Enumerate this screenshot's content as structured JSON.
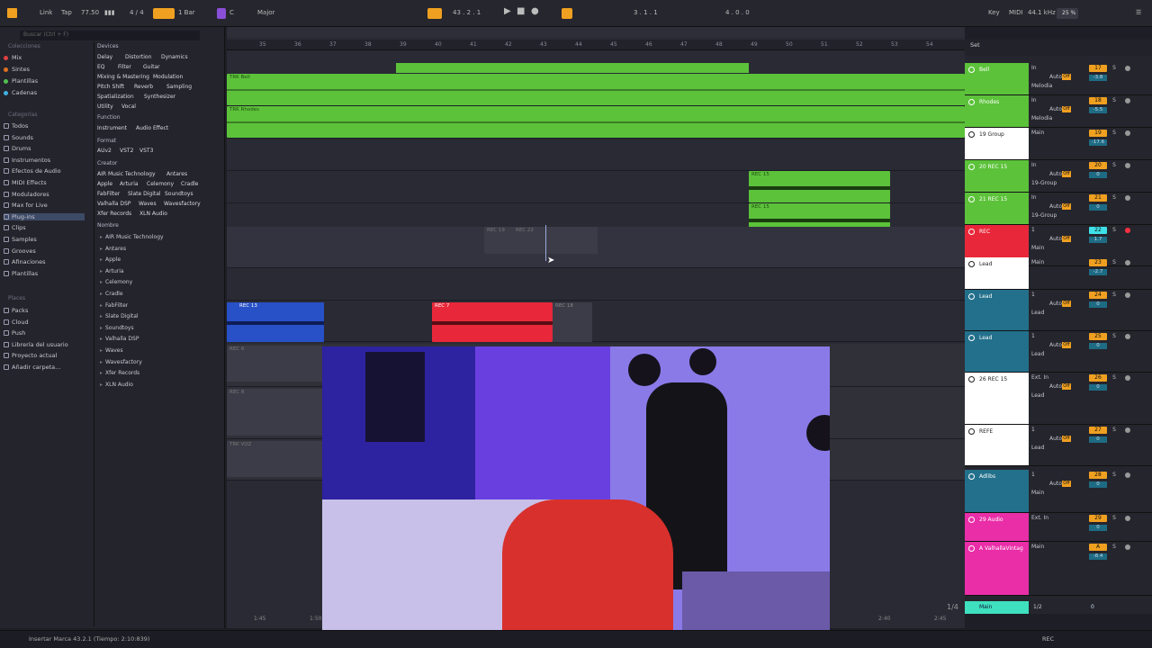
{
  "topbar": {
    "link": "Link",
    "tap": "Tap",
    "bpm": "77.50",
    "sig": "4 / 4",
    "bar": "1 Bar",
    "key": "C",
    "scale": "Major",
    "pos": "43 .  2 .  1",
    "loop": "3 .  1 .  1",
    "len": "4 .  0 .  0",
    "key_label": "Key",
    "midi": "MIDI",
    "rate": "44.1 kHz",
    "cpu": "25 %"
  },
  "browser": {
    "search": "Buscar (Ctrl + F)",
    "collections_label": "Colecciones",
    "collections": [
      {
        "label": "Mix",
        "color": "#e04040"
      },
      {
        "label": "Sintes",
        "color": "#e07020"
      },
      {
        "label": "Plantillas",
        "color": "#50c050"
      },
      {
        "label": "Cadenas",
        "color": "#40b0e0"
      }
    ],
    "categories_label": "Categorías",
    "categories": [
      "Todos",
      "Sounds",
      "Drums",
      "Instrumentos",
      "Efectos de Audio",
      "MIDI Effects",
      "Moduladores",
      "Max for Live",
      "Plug-ins",
      "Clips",
      "Samples",
      "Grooves",
      "Afinaciones",
      "Plantillas"
    ],
    "places_label": "Places",
    "places": [
      "Packs",
      "Cloud",
      "Push",
      "Librería del usuario",
      "Proyecto actual",
      "Añadir carpeta..."
    ],
    "devices_label": "Devices",
    "device_tags": [
      "Delay",
      "Distortion",
      "Dynamics",
      "EQ",
      "Filter",
      "Guitar",
      "Mixing & Mastering",
      "Modulation",
      "Pitch Shift",
      "Reverb",
      "Sampling",
      "Spatialization",
      "Synthesizer",
      "Utility",
      "Vocal"
    ],
    "function_label": "Function",
    "function_tags": [
      "Instrument",
      "Audio Effect"
    ],
    "format_label": "Format",
    "format_tags": [
      "AUv2",
      "VST2",
      "VST3"
    ],
    "creator_label": "Creator",
    "creator_tags": [
      "AIR Music Technology",
      "Antares",
      "Apple",
      "Arturia",
      "Celemony",
      "Cradle",
      "FabFilter",
      "Slate Digital",
      "Soundtoys",
      "Valhalla DSP",
      "Waves",
      "Wavesfactory",
      "Xfer Records",
      "XLN Audio"
    ],
    "list_label": "Nombre",
    "list": [
      "AIR Music Technology",
      "Antares",
      "Apple",
      "Arturia",
      "Celemony",
      "Cradle",
      "FabFilter",
      "Slate Digital",
      "Soundtoys",
      "Valhalla DSP",
      "Waves",
      "Wavesfactory",
      "Xfer Records",
      "XLN Audio"
    ]
  },
  "ruler": [
    "35",
    "36",
    "37",
    "38",
    "39",
    "40",
    "41",
    "42",
    "43",
    "44",
    "45",
    "46",
    "47",
    "48",
    "49",
    "50",
    "51",
    "52",
    "53",
    "54"
  ],
  "clips": {
    "bell": "TRK Bell",
    "rhodes": "TRK Rhodes",
    "rec15a": "REC 15",
    "rec15b": "REC 15",
    "rec19": "REC 19",
    "rec22": "REC 22",
    "rec13": "REC 13",
    "rec7": "REC 7",
    "rec18": "REC 18",
    "rec6": "REC 6",
    "rec8": "REC 8",
    "trkvoz": "TRK VOZ"
  },
  "timeline": {
    "t1": "1:45",
    "t2": "1:50",
    "t3": "2:40",
    "t4": "2:45",
    "page": "1/4"
  },
  "mixer": {
    "set": "Set",
    "tracks": [
      {
        "name": "Bell",
        "color": "#5cc23a",
        "in": "In",
        "auto": "Auto",
        "route": "Melodia",
        "n": "17",
        "vol": "-3.8"
      },
      {
        "name": "Rhodes",
        "color": "#5cc23a",
        "in": "In",
        "auto": "Auto",
        "route": "Melodia",
        "n": "18",
        "vol": "-5.5"
      },
      {
        "name": "19 Group",
        "color": "#ffffff",
        "in": "Main",
        "auto": "",
        "route": "",
        "n": "19",
        "vol": "-17.6"
      },
      {
        "name": "20 REC 15",
        "color": "#5cc23a",
        "in": "In",
        "auto": "Auto",
        "route": "19-Group",
        "n": "20",
        "vol": "0"
      },
      {
        "name": "21 REC 15",
        "color": "#5cc23a",
        "in": "In",
        "auto": "Auto",
        "route": "19-Group",
        "n": "21",
        "vol": "0"
      },
      {
        "name": "REC",
        "color": "#e8283a",
        "in": "1",
        "auto": "Auto",
        "route": "Main",
        "n": "22",
        "vol": "1.7"
      },
      {
        "name": "Lead",
        "color": "#ffffff",
        "in": "Main",
        "auto": "",
        "route": "",
        "n": "23",
        "vol": "-2.7"
      },
      {
        "name": "Lead",
        "color": "#23708c",
        "in": "1",
        "auto": "Auto",
        "route": "Lead",
        "n": "24",
        "vol": "0"
      },
      {
        "name": "Lead",
        "color": "#23708c",
        "in": "1",
        "auto": "Auto",
        "route": "Lead",
        "n": "25",
        "vol": "0"
      },
      {
        "name": "26 REC 15",
        "color": "#ffffff",
        "in": "Ext. In",
        "auto": "Auto",
        "route": "Lead",
        "n": "26",
        "vol": "0"
      },
      {
        "name": "REFE",
        "color": "#ffffff",
        "in": "1",
        "auto": "Auto",
        "route": "Lead",
        "n": "27",
        "vol": "0"
      },
      {
        "name": "Adlibs",
        "color": "#23708c",
        "in": "1",
        "auto": "Auto",
        "route": "Main",
        "n": "28",
        "vol": "0"
      },
      {
        "name": "29 Audio",
        "color": "#e92ea8",
        "in": "Ext. In",
        "auto": "",
        "route": "",
        "n": "29",
        "vol": "0"
      },
      {
        "name": "A ValhallaVintag",
        "color": "#e92ea8",
        "in": "Main",
        "auto": "",
        "route": "",
        "n": "A",
        "vol": "-8.4"
      }
    ],
    "main": "Main",
    "main_vol": "0",
    "main_io": "1/2"
  },
  "status": {
    "text": "Insertar Marca 43.2.1 (Tiempo: 2:10:839)",
    "rec": "REC"
  }
}
